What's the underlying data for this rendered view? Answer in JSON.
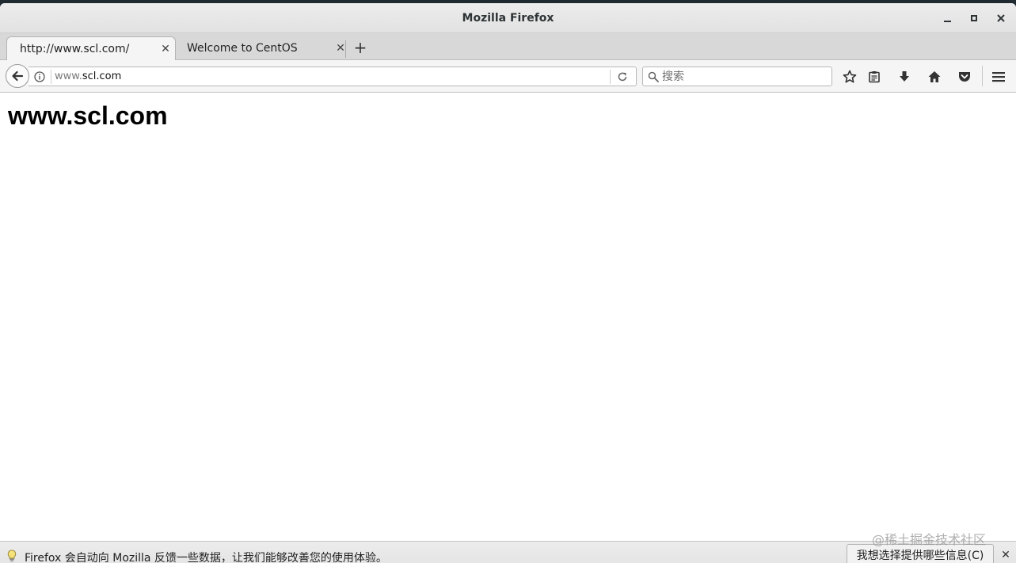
{
  "window": {
    "title": "Mozilla Firefox"
  },
  "tabs": [
    {
      "label": "http://www.scl.com/",
      "active": true
    },
    {
      "label": "Welcome to CentOS",
      "active": false
    }
  ],
  "navbar": {
    "url_prefix": "www.",
    "url_domain": "scl.com",
    "search_placeholder": "搜索"
  },
  "page": {
    "heading": "www.scl.com"
  },
  "notification": {
    "text": "Firefox 会自动向 Mozilla 反馈一些数据，让我们能够改善您的使用体验。",
    "button_label": "我想选择提供哪些信息(C)"
  },
  "watermark": "@稀土掘金技术社区",
  "icons": {
    "back": "back-arrow-icon",
    "info": "info-icon",
    "reload": "reload-icon",
    "search": "search-icon",
    "bookmark": "star-icon",
    "reader": "clipboard-icon",
    "download": "download-arrow-icon",
    "home": "home-icon",
    "pocket": "pocket-icon",
    "menu": "hamburger-menu-icon",
    "notification": "lightbulb-icon"
  },
  "colors": {
    "background": "#1e2a30",
    "chrome": "#f5f5f5",
    "tabstrip": "#d8d8d8"
  }
}
